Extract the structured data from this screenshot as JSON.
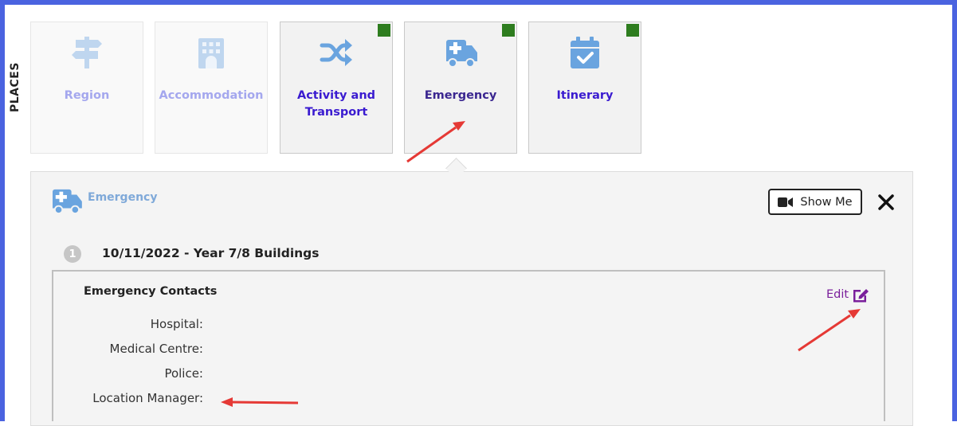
{
  "sidebar_label": "PLACES",
  "tiles": [
    {
      "label": "Region",
      "icon": "signpost-icon",
      "state": "dim"
    },
    {
      "label": "Accommodation",
      "icon": "building-icon",
      "state": "dim"
    },
    {
      "label": "Activity and Transport",
      "icon": "shuffle-icon",
      "state": "active"
    },
    {
      "label": "Emergency",
      "icon": "ambulance-icon",
      "state": "selected"
    },
    {
      "label": "Itinerary",
      "icon": "calendar-check-icon",
      "state": "active"
    }
  ],
  "panel": {
    "title": "Emergency",
    "show_me_label": "Show Me",
    "step_number": "1",
    "step_title": "10/11/2022 - Year 7/8 Buildings",
    "contacts_title": "Emergency Contacts",
    "edit_label": "Edit",
    "fields": [
      "Hospital:",
      "Medical Centre:",
      "Police:",
      "Location Manager:"
    ]
  },
  "colors": {
    "frame": "#4a63e0",
    "complete_flag": "#2e7d1f",
    "icon_blue": "#6aa4df",
    "edit_purple": "#7a1f9b",
    "annotation_arrow": "#e53935"
  }
}
